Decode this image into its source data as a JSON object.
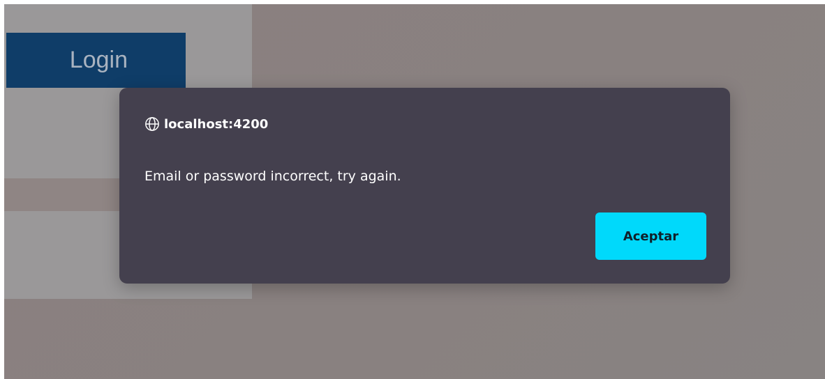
{
  "login_panel": {
    "header_label": "Login"
  },
  "dialog": {
    "origin": "localhost:4200",
    "origin_icon": "globe-icon",
    "message": "Email or password incorrect, try again.",
    "accept_label": "Aceptar"
  },
  "colors": {
    "dialog_background": "#44404e",
    "accept_button": "#00d9fb",
    "login_header": "#0f3d68"
  }
}
